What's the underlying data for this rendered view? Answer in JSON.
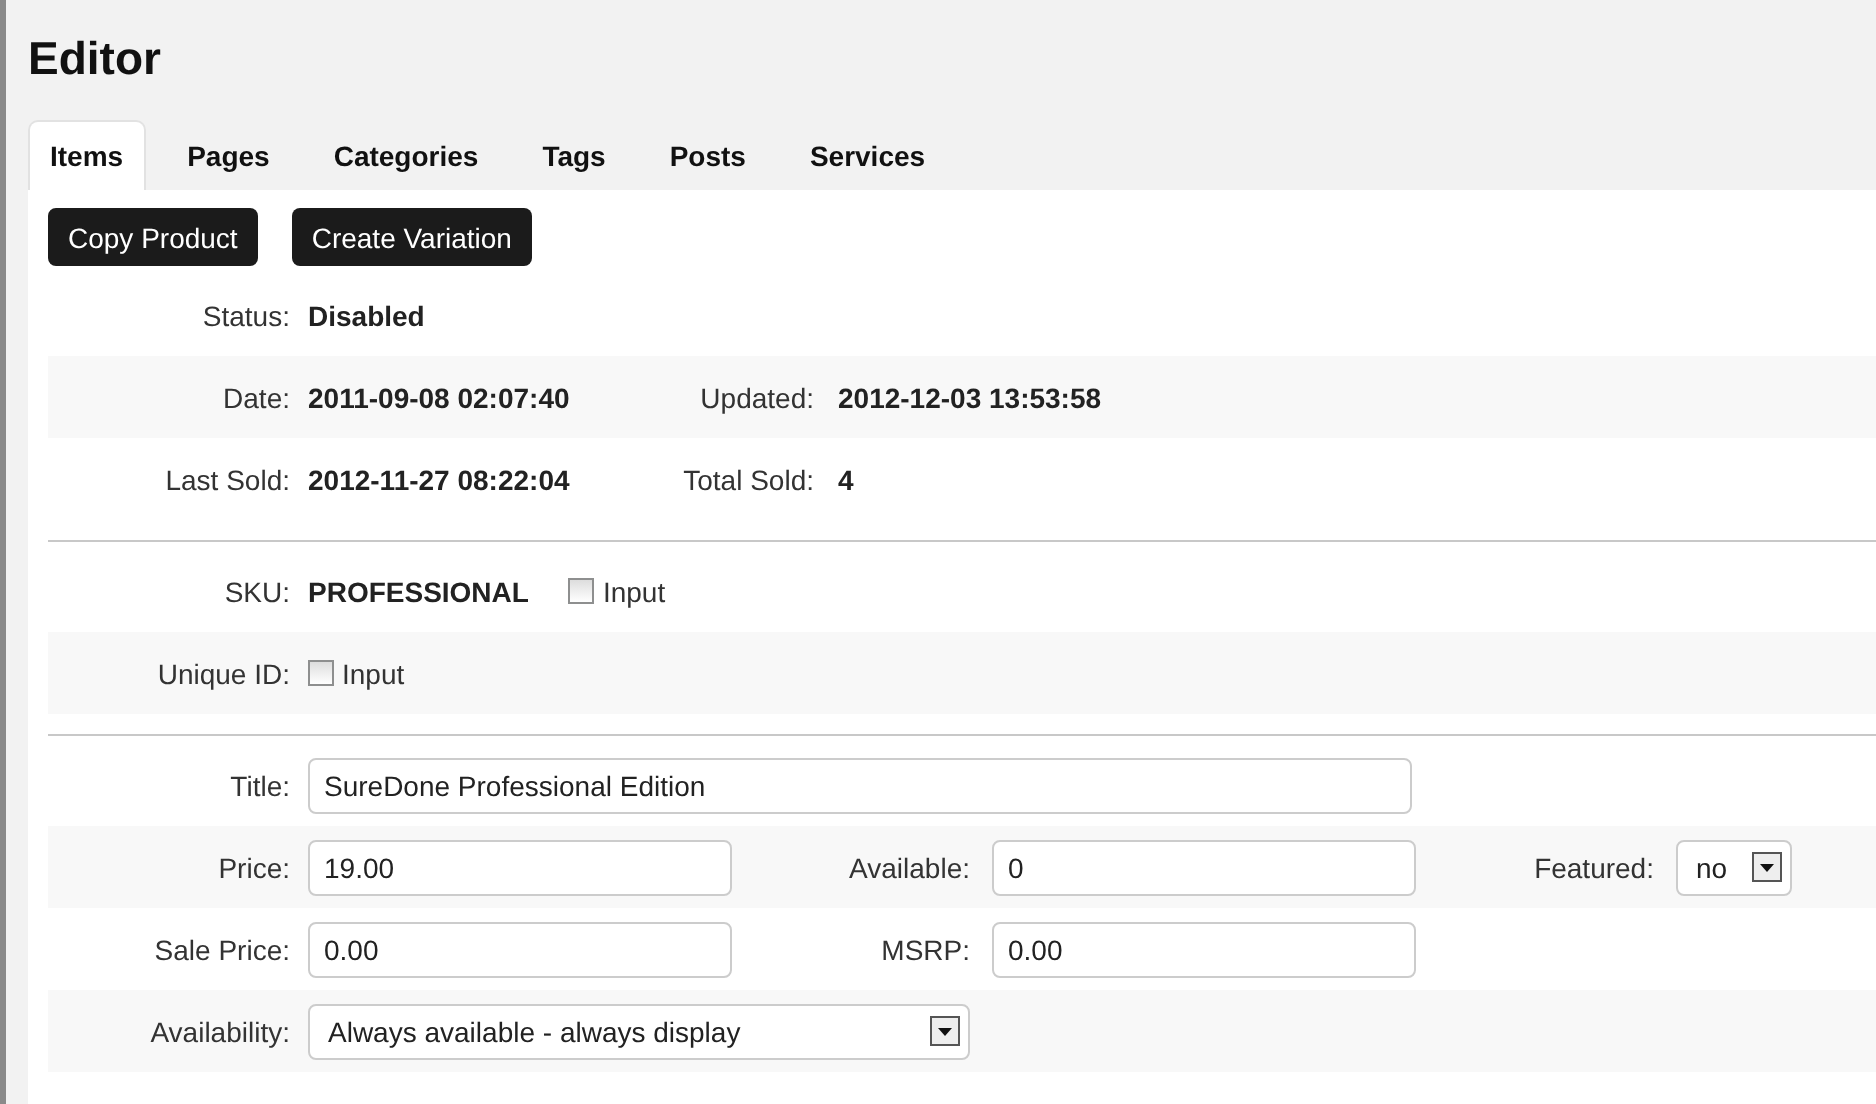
{
  "title": "Editor",
  "tabs": [
    {
      "label": "Items",
      "selected": true
    },
    {
      "label": "Pages",
      "selected": false
    },
    {
      "label": "Categories",
      "selected": false
    },
    {
      "label": "Tags",
      "selected": false
    },
    {
      "label": "Posts",
      "selected": false
    },
    {
      "label": "Services",
      "selected": false
    }
  ],
  "buttons": [
    "Copy Product",
    "Create Variation"
  ],
  "sections": [
    {
      "rows": [
        {
          "kind": "info",
          "items": [
            {
              "label": "Status:",
              "value": "Disabled"
            }
          ]
        },
        {
          "kind": "info",
          "items": [
            {
              "label": "Date:",
              "value": "2011-09-08 02:07:40"
            },
            {
              "label": "Updated:",
              "value": "2012-12-03 13:53:58"
            }
          ]
        },
        {
          "kind": "info",
          "items": [
            {
              "label": "Last Sold:",
              "value": "2012-11-27 08:22:04"
            },
            {
              "label": "Total Sold:",
              "value": "4"
            }
          ]
        }
      ]
    },
    {
      "rows": [
        {
          "kind": "check",
          "label": "SKU:",
          "value": "PROFESSIONAL",
          "checkbox": {
            "label": "Input",
            "checked": false
          }
        },
        {
          "kind": "check",
          "label": "Unique ID:",
          "checkbox": {
            "label": "Input",
            "checked": false
          }
        }
      ]
    },
    {
      "rows": [
        {
          "kind": "form",
          "items": [
            {
              "label": "Title:",
              "kind": "text",
              "value": "SureDone Professional Edition"
            }
          ]
        },
        {
          "kind": "form",
          "items": [
            {
              "label": "Price:",
              "kind": "text",
              "value": "19.00"
            },
            {
              "label": "Available:",
              "kind": "text",
              "value": "0"
            },
            {
              "label": "Featured:",
              "kind": "select",
              "value": "no"
            }
          ]
        },
        {
          "kind": "form",
          "items": [
            {
              "label": "Sale Price:",
              "kind": "text",
              "value": "0.00"
            },
            {
              "label": "MSRP:",
              "kind": "text",
              "value": "0.00"
            }
          ]
        },
        {
          "kind": "form",
          "items": [
            {
              "label": "Availability:",
              "kind": "select",
              "value": "Always available - always display"
            }
          ]
        }
      ]
    }
  ]
}
